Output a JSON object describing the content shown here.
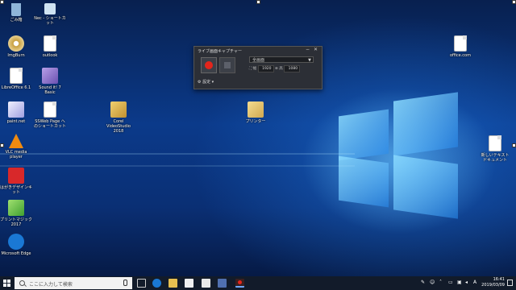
{
  "desktop_icons": [
    {
      "id": "recycle",
      "label": "ごみ箱",
      "color": "#8fb6d9"
    },
    {
      "id": "nec",
      "label": "Nec - ショートカット",
      "color": "#cfe3f2"
    },
    {
      "id": "imgburn",
      "label": "ImgBurn",
      "color": "#c8a040"
    },
    {
      "id": "outlook",
      "label": "outlook",
      "color": "#ffffff"
    },
    {
      "id": "libreoffice",
      "label": "LibreOffice 6.1",
      "color": "#ffffff"
    },
    {
      "id": "soundit",
      "label": "Sound it! 7 Basic",
      "color": "#9a7fd0"
    },
    {
      "id": "paintnet",
      "label": "paint.net",
      "color": "#e8e8f8"
    },
    {
      "id": "sswweb",
      "label": "SSWeb Page へのショートカット",
      "color": "#ffffff"
    },
    {
      "id": "corel",
      "label": "Corel VideoStudio 2018",
      "color": "#e0b040"
    },
    {
      "id": "printer",
      "label": "プリンター",
      "color": "#e6c87a"
    },
    {
      "id": "vlc",
      "label": "VLC media player",
      "color": "#f08a10"
    },
    {
      "id": "hagaki",
      "label": "はがきデザインキット",
      "color": "#d8282a"
    },
    {
      "id": "printmagic",
      "label": "プリントマジック2017",
      "color": "#6ac04a"
    },
    {
      "id": "edge",
      "label": "Microsoft Edge",
      "color": "#1a78d4"
    },
    {
      "id": "officecom",
      "label": "office.com",
      "color": "#ffffff"
    },
    {
      "id": "newtext",
      "label": "新しいテキスト ドキュメント",
      "color": "#ffffff"
    }
  ],
  "capture_window": {
    "title": "ライブ画面キャプチャー",
    "minimize": "−",
    "close": "✕",
    "mode_value": "全画面",
    "width_label": "幅",
    "width_value": "1920",
    "height_label": "高",
    "height_value": "1080",
    "settings_label": "設定 ▾"
  },
  "taskbar": {
    "search_placeholder": "ここに入力して検索",
    "time": "16:41",
    "date": "2019/03/09",
    "ime": "A"
  },
  "colors": {
    "record": "#e3251b",
    "taskbar": "#121b2a",
    "accent": "#1a78d4"
  }
}
